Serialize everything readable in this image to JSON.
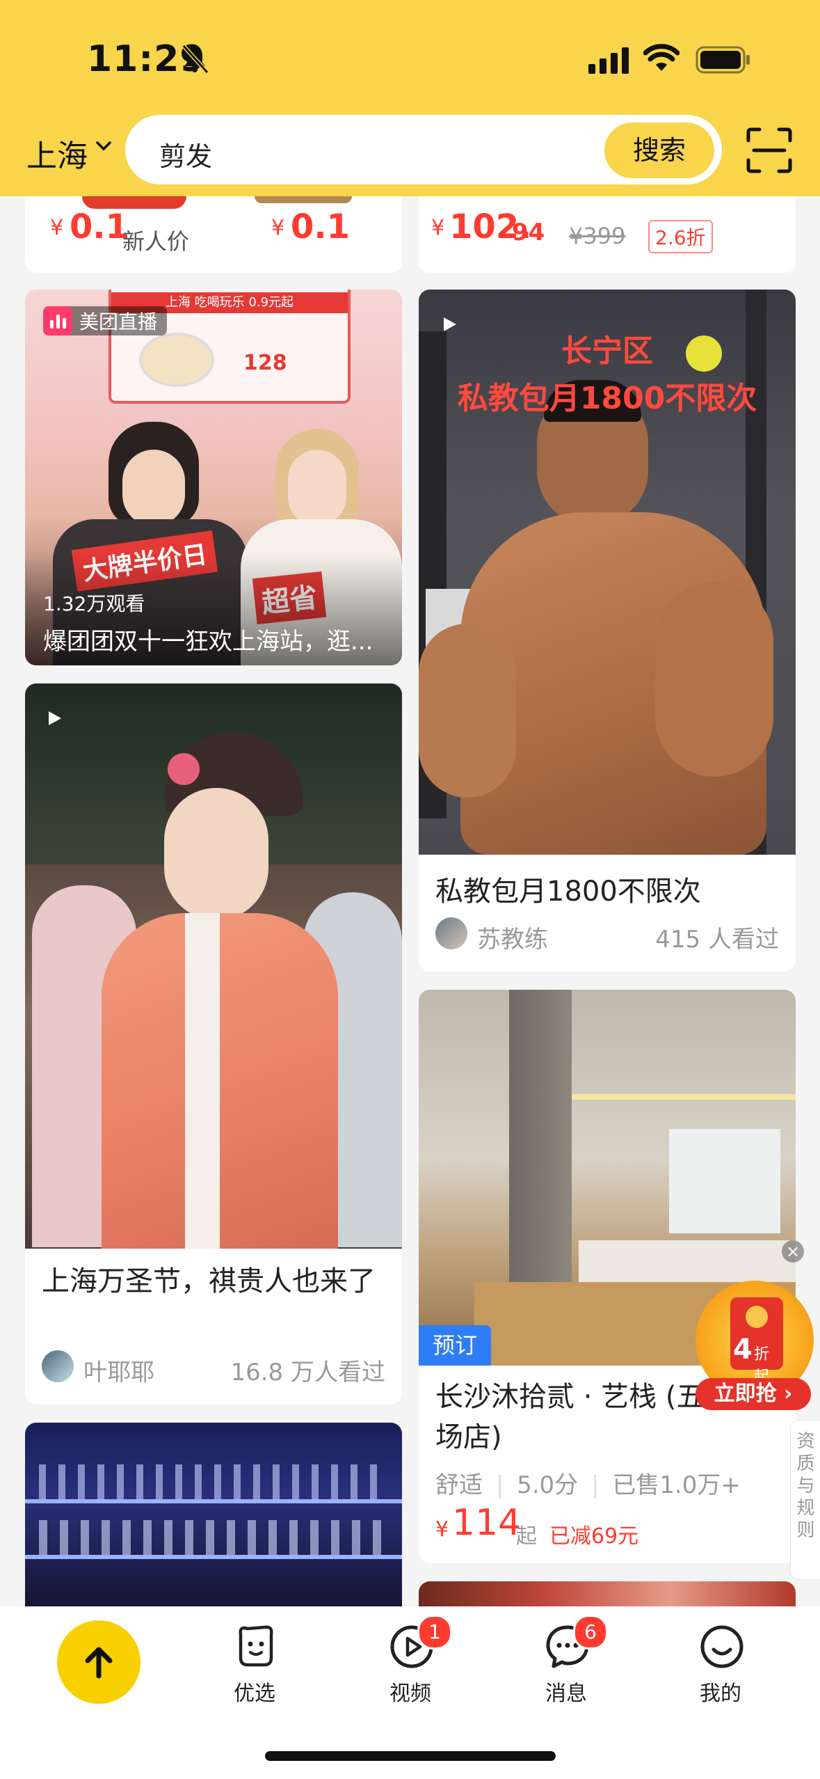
{
  "status_bar": {
    "time": "11:29"
  },
  "header": {
    "city": "上海",
    "search_query": "剪发",
    "search_button": "搜索"
  },
  "top_cards": {
    "left": {
      "price1_symbol": "¥",
      "price1": "0.1",
      "price1_tag": "新人价",
      "price2_symbol": "¥",
      "price2": "0.1"
    },
    "right": {
      "price_symbol": "¥",
      "price_int": "102.",
      "price_dec": "94",
      "original_price": "¥399",
      "discount": "2.6折"
    }
  },
  "live_card": {
    "live_badge": "美团直播",
    "viewers": "1.32万观看",
    "title": "爆团团双十一狂欢上海站，逛...",
    "overlay_banner": "上海 吃喝玩乐 0.9元起",
    "overlay_price": "128",
    "overlay_sign_left": "大牌半价日",
    "overlay_sign_right": "超省"
  },
  "trainer_card": {
    "overlay_line1": "长宁区",
    "overlay_line2": "私教包月1800不限次",
    "title": "私教包月1800不限次",
    "author": "苏教练",
    "views": "415 人看过"
  },
  "halloween_card": {
    "title": "上海万圣节，祺贵人也来了",
    "author": "叶耶耶",
    "views": "16.8 万人看过"
  },
  "hotel_card": {
    "tag": "预订",
    "title": "长沙沐拾贰 · 艺栈 (五一广场店)",
    "category": "舒适",
    "rating": "5.0分",
    "sold": "已售1.0万+",
    "price_symbol": "¥",
    "price": "114",
    "price_suffix": "起",
    "saved": "已减69元"
  },
  "floating_promo": {
    "discount_num": "4",
    "discount_text": "折起",
    "cta": "立即抢 ›",
    "side_label": "资质与规则"
  },
  "tabbar": {
    "tabs": [
      {
        "label": "优选"
      },
      {
        "label": "视频",
        "badge": "1"
      },
      {
        "label": "消息",
        "badge": "6"
      },
      {
        "label": "我的"
      }
    ]
  },
  "colors": {
    "brand_yellow": "#f8d54a",
    "price_red": "#ff3b30",
    "text_gray": "#999999"
  }
}
